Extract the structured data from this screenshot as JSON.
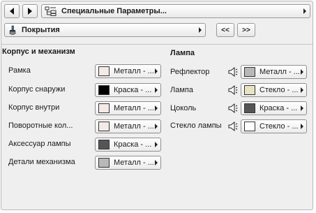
{
  "topbar": {
    "title": "Специальные Параметры..."
  },
  "subbar": {
    "title": "Покрытия",
    "prev_label": "<<",
    "next_label": ">>"
  },
  "left": {
    "title": "Корпус и механизм",
    "rows": [
      {
        "label": "Рамка",
        "material": "Металл - ...",
        "color": "#f3ebe7"
      },
      {
        "label": "Корпус снаружи",
        "material": "Краска - ...",
        "color": "#000000"
      },
      {
        "label": "Корпус внутри",
        "material": "Металл - ...",
        "color": "#f3ebe7"
      },
      {
        "label": "Поворотные кол...",
        "material": "Металл - ...",
        "color": "#f3ebe7"
      },
      {
        "label": "Аксессуар лампы",
        "material": "Краска - ...",
        "color": "#555555"
      },
      {
        "label": "Детали механизма",
        "material": "Металл - ...",
        "color": "#b8b8b8"
      }
    ]
  },
  "right": {
    "title": "Лампа",
    "rows": [
      {
        "label": "Рефлектор",
        "material": "Металл - ...",
        "color": "#b8b8b8"
      },
      {
        "label": "Лампа",
        "material": "Стекло - ...",
        "color": "#e6e4c4"
      },
      {
        "label": "Цоколь",
        "material": "Краска - ...",
        "color": "#555555"
      },
      {
        "label": "Стекло лампы",
        "material": "Стекло - ...",
        "color": "#ffffff"
      }
    ]
  }
}
